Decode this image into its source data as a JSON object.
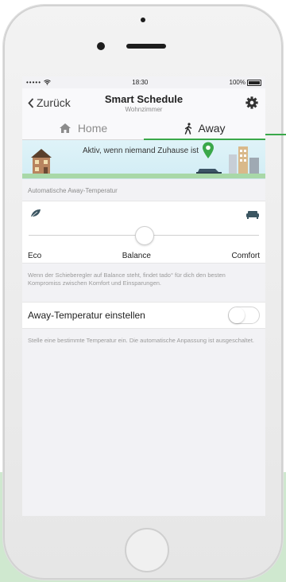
{
  "status_bar": {
    "signal": "•••••",
    "time": "18:30",
    "battery": "100%"
  },
  "nav": {
    "back_label": "Zurück",
    "title": "Smart Schedule",
    "subtitle": "Wohnzimmer"
  },
  "tabs": [
    {
      "label": "Home",
      "icon": "house-icon",
      "active": false
    },
    {
      "label": "Away",
      "icon": "walking-person-icon",
      "active": true
    }
  ],
  "banner": {
    "text": "Aktiv, wenn niemand Zuhause ist"
  },
  "section_label": "Automatische Away-Temperatur",
  "slider": {
    "min_label": "Eco",
    "mid_label": "Balance",
    "max_label": "Comfort",
    "value_fraction": 0.5,
    "left_icon": "leaf-icon",
    "right_icon": "sofa-icon"
  },
  "slider_description": "Wenn der Schieberegler auf Balance steht, findet tado° für dich den besten Kompromiss zwischen Komfort und Einsparungen.",
  "toggle": {
    "label": "Away-Temperatur einstellen",
    "on": false
  },
  "toggle_description": "Stelle eine bestimmte Temperatur ein. Die automatische Anpassung ist ausgeschaltet.",
  "colors": {
    "accent_green": "#3aa84a",
    "background_green": "#cfe8cf"
  }
}
